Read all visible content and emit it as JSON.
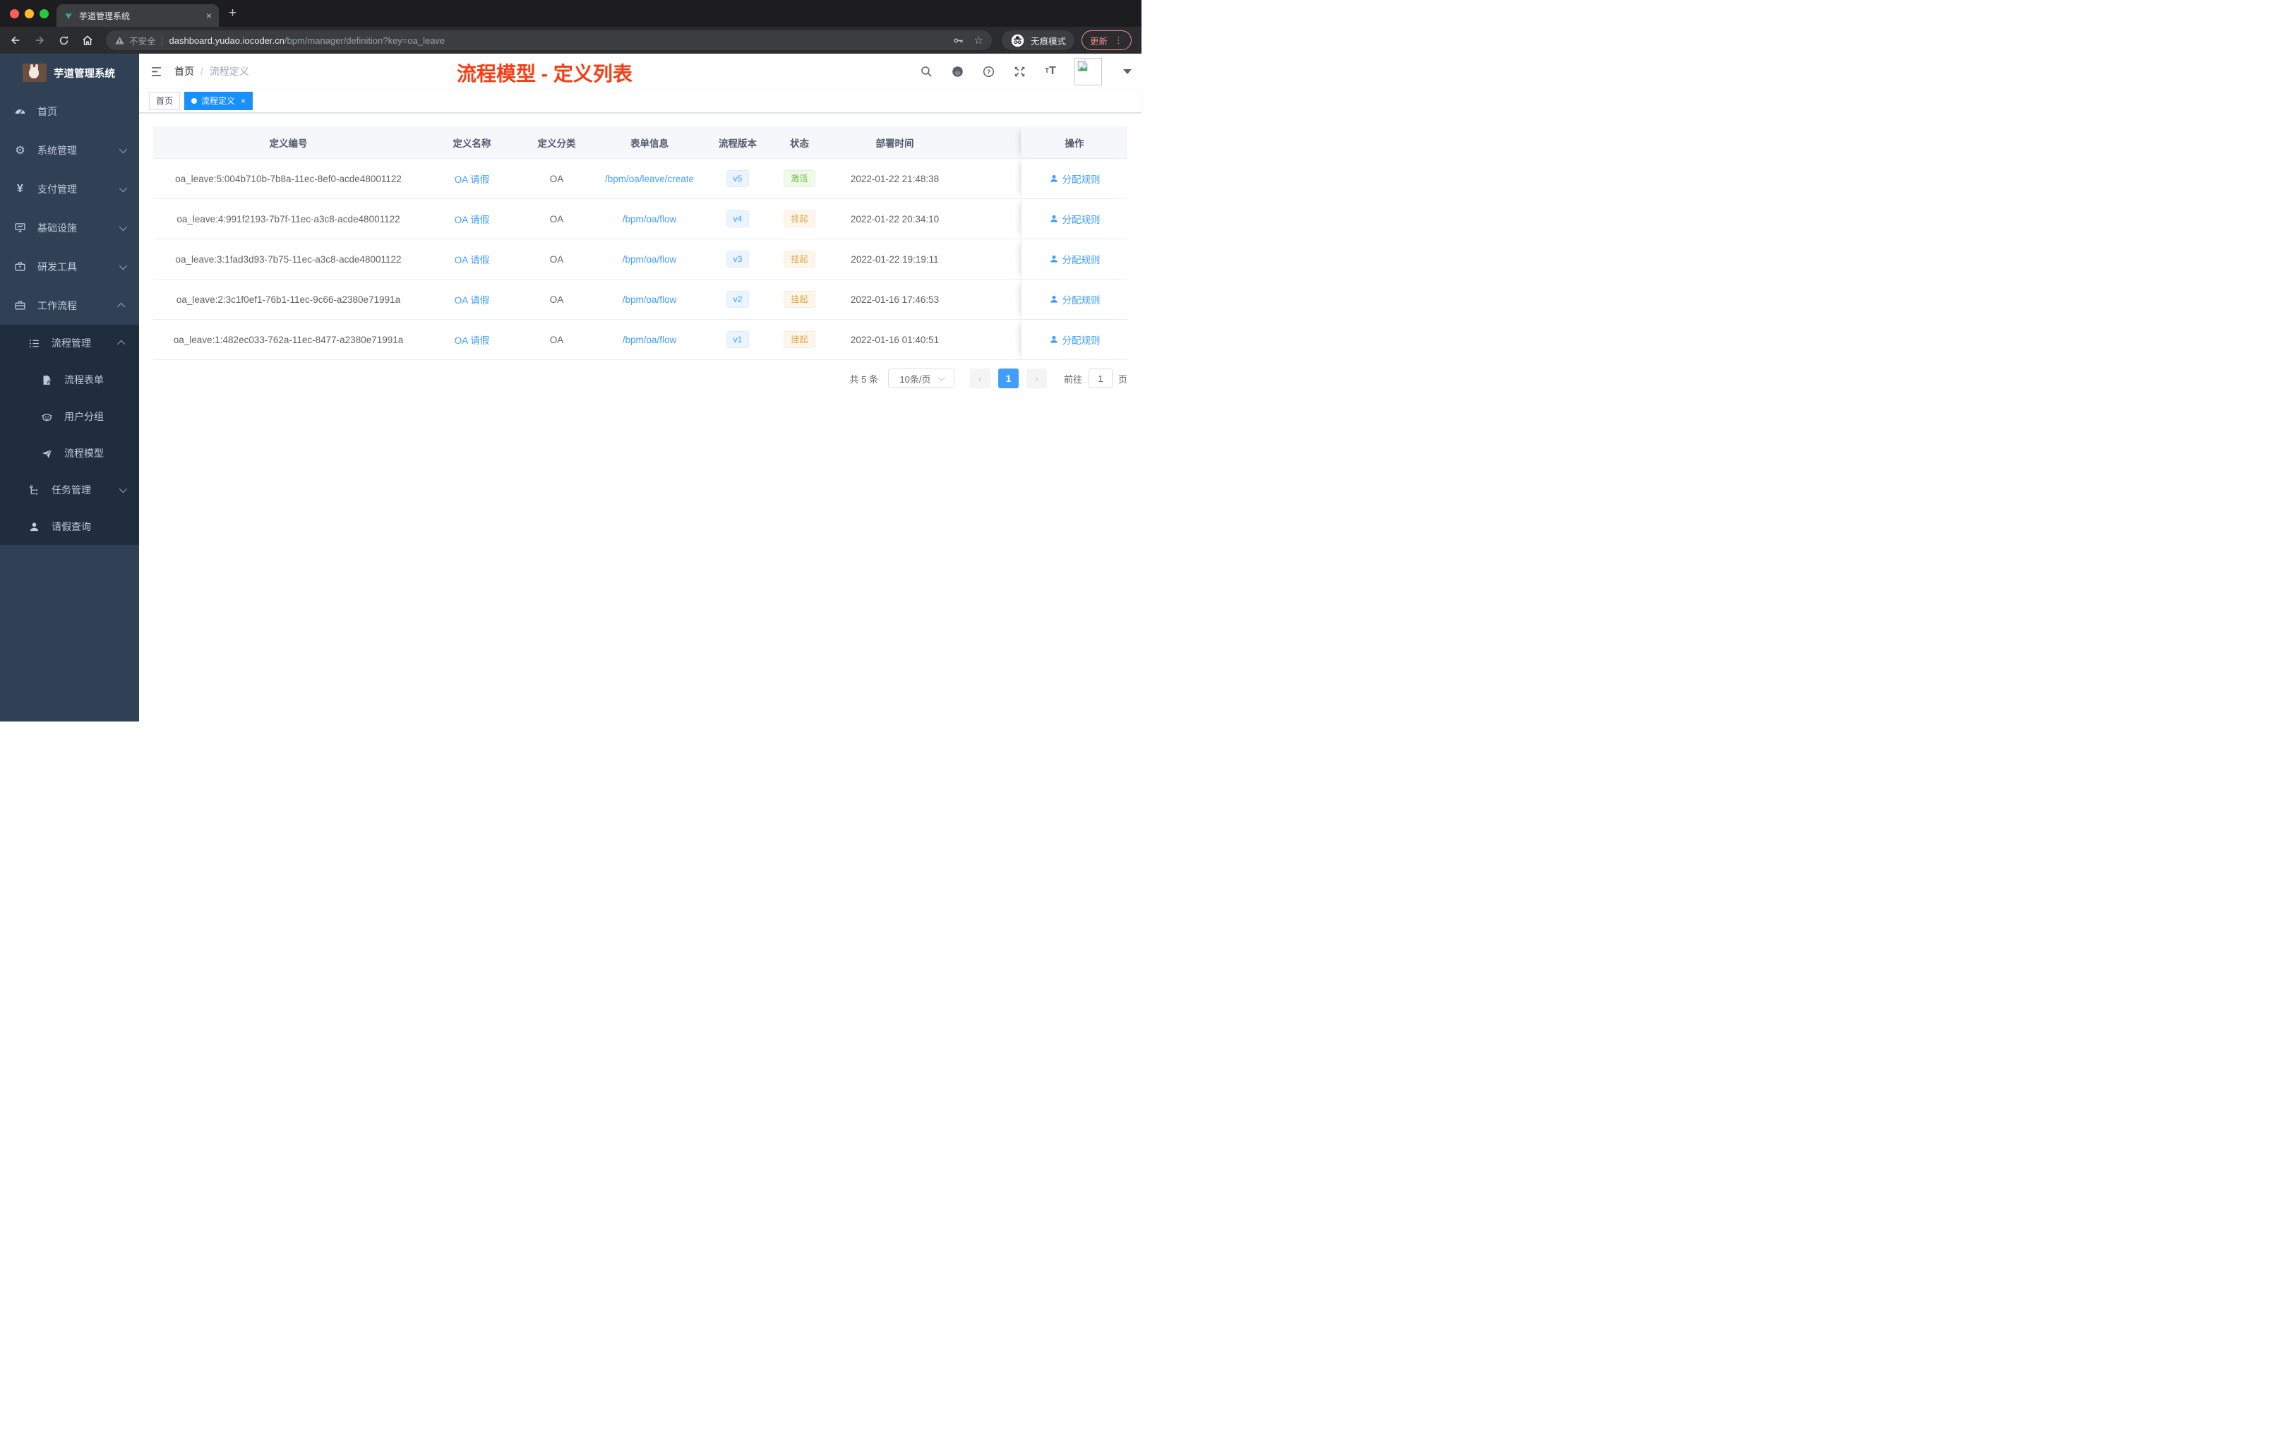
{
  "browser": {
    "tab": {
      "title": "芋道管理系统"
    },
    "toolbar": {
      "security_label": "不安全",
      "url_domain": "dashboard.yudao.iocoder.cn",
      "url_path": "/bpm/manager/definition?key=oa_leave",
      "incognito_label": "无痕模式",
      "update_label": "更新"
    }
  },
  "glyphs": {
    "close": "×",
    "new_tab": "+",
    "star": "☆",
    "dots": "⋮",
    "prev": "‹",
    "next": "›",
    "yen": "¥",
    "gear": "⚙",
    "help": "?",
    "tag_close": "×",
    "font_small": "T",
    "font_big": "T"
  },
  "header": {
    "breadcrumb": {
      "home": "首页",
      "separator": "/",
      "current": "流程定义"
    },
    "annotation": "流程模型 - 定义列表"
  },
  "sidebar": {
    "logo_title": "芋道管理系统",
    "items": [
      {
        "label": "首页",
        "icon": "dashboard-icon"
      },
      {
        "label": "系统管理",
        "icon": "gear-icon",
        "chevron": "down"
      },
      {
        "label": "支付管理",
        "icon": "yen-icon",
        "chevron": "down"
      },
      {
        "label": "基础设施",
        "icon": "monitor-icon",
        "chevron": "down"
      },
      {
        "label": "研发工具",
        "icon": "toolbox-icon",
        "chevron": "down"
      },
      {
        "label": "工作流程",
        "icon": "briefcase-icon",
        "chevron": "up"
      },
      {
        "label": "流程管理",
        "icon": "list-icon",
        "chevron": "up"
      },
      {
        "label": "流程表单",
        "icon": "form-icon"
      },
      {
        "label": "用户分组",
        "icon": "user-group-icon"
      },
      {
        "label": "流程模型",
        "icon": "paper-plane-icon"
      },
      {
        "label": "任务管理",
        "icon": "task-tree-icon",
        "chevron": "down"
      },
      {
        "label": "请假查询",
        "icon": "person-icon"
      }
    ]
  },
  "tags": [
    {
      "label": "首页",
      "active": false
    },
    {
      "label": "流程定义",
      "active": true,
      "closable": true
    }
  ],
  "table": {
    "columns": [
      "定义编号",
      "定义名称",
      "定义分类",
      "表单信息",
      "流程版本",
      "状态",
      "部署时间",
      "操作"
    ],
    "rows": [
      {
        "id": "oa_leave:5:004b710b-7b8a-11ec-8ef0-acde48001122",
        "name": "OA 请假",
        "category": "OA",
        "form": "/bpm/oa/leave/create",
        "version": "v5",
        "status": "激活",
        "status_type": "success",
        "deployed": "2022-01-22 21:48:38",
        "action": "分配规则"
      },
      {
        "id": "oa_leave:4:991f2193-7b7f-11ec-a3c8-acde48001122",
        "name": "OA 请假",
        "category": "OA",
        "form": "/bpm/oa/flow",
        "version": "v4",
        "status": "挂起",
        "status_type": "warning",
        "deployed": "2022-01-22 20:34:10",
        "action": "分配规则"
      },
      {
        "id": "oa_leave:3:1fad3d93-7b75-11ec-a3c8-acde48001122",
        "name": "OA 请假",
        "category": "OA",
        "form": "/bpm/oa/flow",
        "version": "v3",
        "status": "挂起",
        "status_type": "warning",
        "deployed": "2022-01-22 19:19:11",
        "action": "分配规则"
      },
      {
        "id": "oa_leave:2:3c1f0ef1-76b1-11ec-9c66-a2380e71991a",
        "name": "OA 请假",
        "category": "OA",
        "form": "/bpm/oa/flow",
        "version": "v2",
        "status": "挂起",
        "status_type": "warning",
        "deployed": "2022-01-16 17:46:53",
        "action": "分配规则"
      },
      {
        "id": "oa_leave:1:482ec033-762a-11ec-8477-a2380e71991a",
        "name": "OA 请假",
        "category": "OA",
        "form": "/bpm/oa/flow",
        "version": "v1",
        "status": "挂起",
        "status_type": "warning",
        "deployed": "2022-01-16 01:40:51",
        "action": "分配规则"
      }
    ]
  },
  "pagination": {
    "total": "共 5 条",
    "page_size": "10条/页",
    "current_page": "1",
    "goto_label": "前往",
    "goto_value": "1",
    "unit_label": "页"
  },
  "colors": {
    "sidebar_bg": "#304156",
    "sidebar_submenu_bg": "#1f2d3d",
    "sidebar_text": "#bfcbd9",
    "active_tag": "#1890ff",
    "link": "#409eff",
    "annotation_red": "#f73d14",
    "badge_info_bg": "#ecf5ff",
    "badge_info_text": "#409eff",
    "badge_success_bg": "#f0f9eb",
    "badge_success_text": "#67c23a",
    "badge_warning_bg": "#fdf6ec",
    "badge_warning_text": "#e6a23c",
    "table_header_bg": "#f5f7fa",
    "update_pill": "#f28b82",
    "traffic_red": "#ff5f57",
    "traffic_yellow": "#febc2e",
    "traffic_green": "#28c840"
  }
}
